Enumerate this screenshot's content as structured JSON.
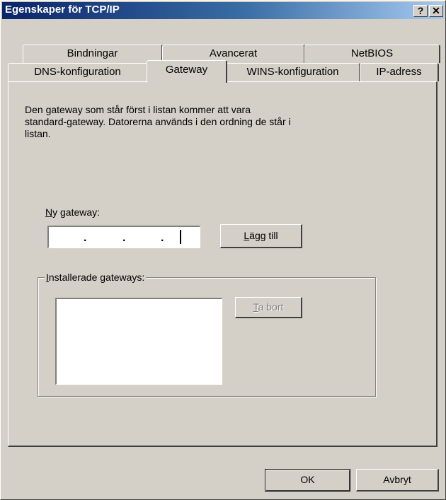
{
  "window": {
    "title": "Egenskaper för TCP/IP",
    "help_button": "?",
    "close_button": "✕"
  },
  "tabs": {
    "row1": [
      "Bindningar",
      "Avancerat",
      "NetBIOS"
    ],
    "row2": [
      "DNS-konfiguration",
      "Gateway",
      "WINS-konfiguration",
      "IP-adress"
    ],
    "active": "Gateway"
  },
  "description": {
    "line1": "Den gateway som står först i listan kommer att vara",
    "line2": "standard-gateway. Datorerna används i den ordning de står i",
    "line3": "listan."
  },
  "new_gateway": {
    "label_mnemonic": "N",
    "label_rest": "y gateway:",
    "ip_value": ". . ."
  },
  "add_button": {
    "mnemonic": "L",
    "rest": "ägg till"
  },
  "installed": {
    "label_mnemonic": "I",
    "label_rest": "nstallerade gateways:",
    "items": []
  },
  "remove_button": {
    "mnemonic": "T",
    "rest": "a bort"
  },
  "footer": {
    "ok": "OK",
    "cancel": "Avbryt"
  }
}
